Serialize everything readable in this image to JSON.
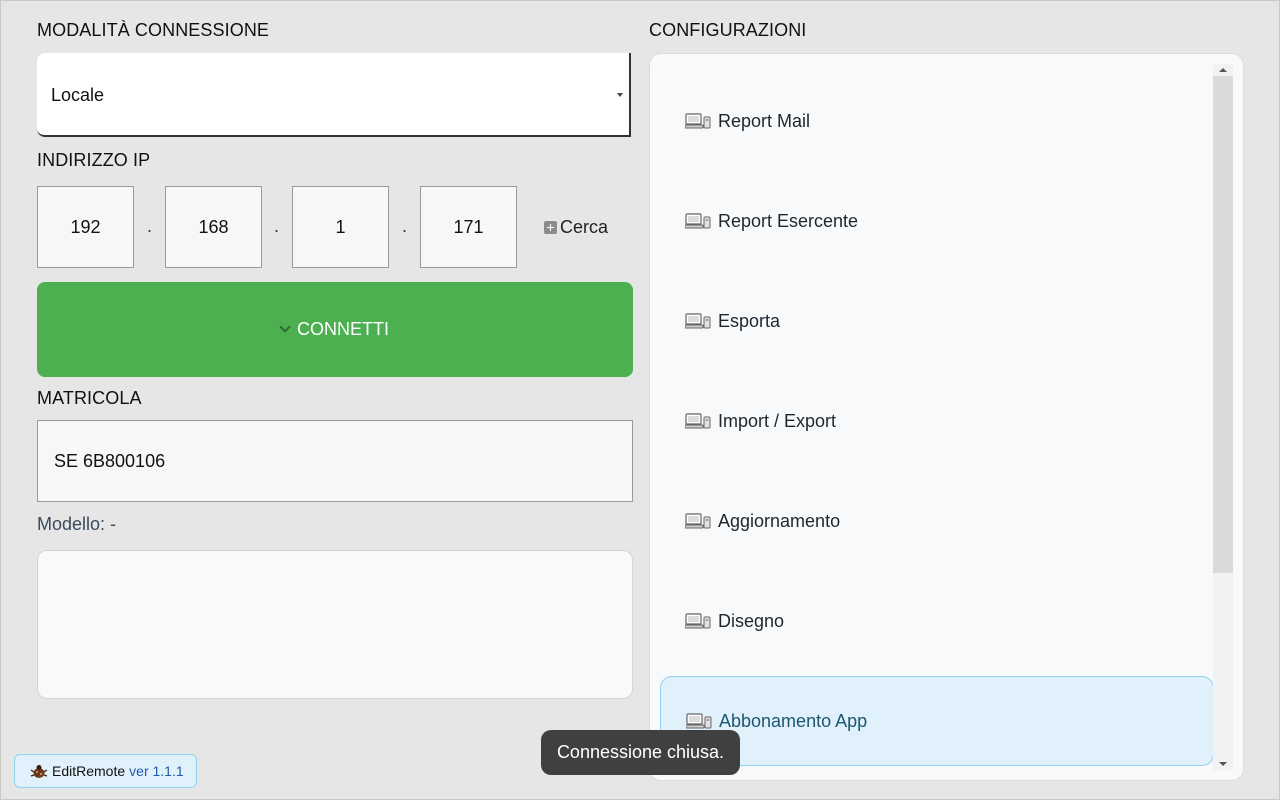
{
  "connection": {
    "title": "MODALITÀ CONNESSIONE",
    "mode_value": "Locale"
  },
  "ip": {
    "title": "INDIRIZZO IP",
    "octets": [
      "192",
      "168",
      "1",
      "171"
    ],
    "separator": ".",
    "search_label": "Cerca"
  },
  "connect_button": {
    "label": "CONNETTI",
    "color": "#4caf50"
  },
  "matricola": {
    "title": "MATRICOLA",
    "value": "SE 6B800106"
  },
  "modello": {
    "label": "Modello: -"
  },
  "configurations": {
    "title": "CONFIGURAZIONI",
    "items": [
      {
        "label": "Report Mail",
        "icon": "computer-icon"
      },
      {
        "label": "Report Esercente",
        "icon": "computer-icon"
      },
      {
        "label": "Esporta",
        "icon": "computer-icon"
      },
      {
        "label": "Import / Export",
        "icon": "computer-icon"
      },
      {
        "label": "Aggiornamento",
        "icon": "computer-icon"
      },
      {
        "label": "Disegno",
        "icon": "computer-icon"
      },
      {
        "label": "Abbonamento App",
        "icon": "computer-icon",
        "selected": true
      }
    ]
  },
  "toast": {
    "message": "Connessione chiusa."
  },
  "footer": {
    "app_name": "EditRemote",
    "version": "ver 1.1.1"
  }
}
